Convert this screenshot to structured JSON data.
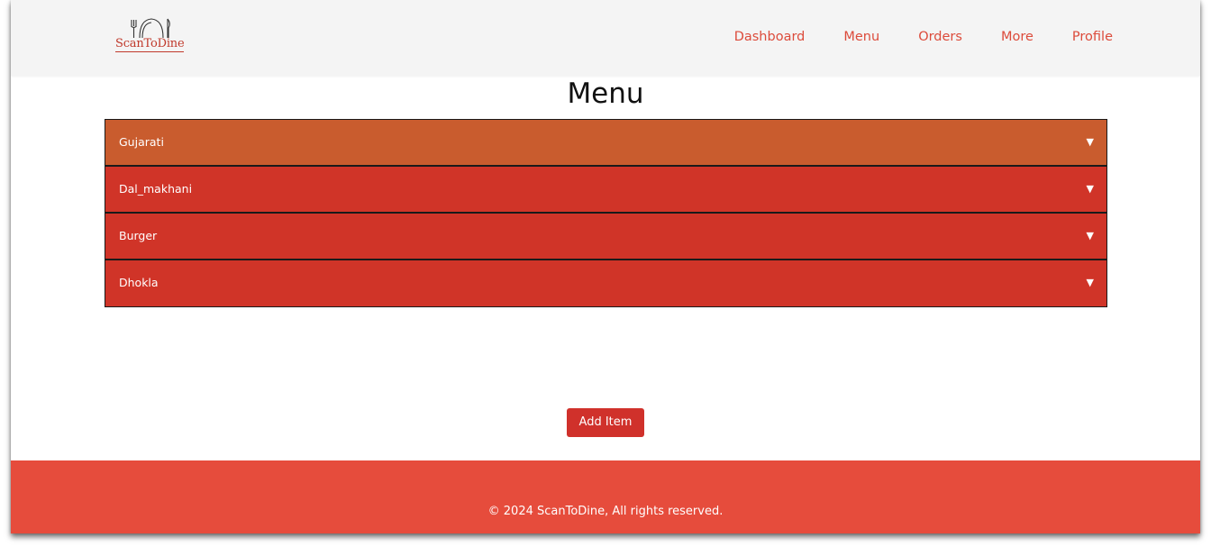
{
  "brand": {
    "logo_text": "ScanToDine"
  },
  "nav": {
    "items": [
      {
        "label": "Dashboard"
      },
      {
        "label": "Menu"
      },
      {
        "label": "Orders"
      },
      {
        "label": "More"
      },
      {
        "label": "Profile"
      }
    ]
  },
  "page": {
    "title": "Menu"
  },
  "menu_categories": [
    {
      "label": "Gujarati",
      "state": "active",
      "arrow_icon": "caret-down-icon"
    },
    {
      "label": "Dal_makhani",
      "state": "default",
      "arrow_icon": "caret-down-icon"
    },
    {
      "label": "Burger",
      "state": "default",
      "arrow_icon": "caret-down-icon"
    },
    {
      "label": "Dhokla",
      "state": "default",
      "arrow_icon": "caret-down-icon"
    }
  ],
  "arrow_glyph": "▼",
  "actions": {
    "add_item_label": "Add Item"
  },
  "footer": {
    "text": "© 2024 ScanToDine, All rights reserved."
  },
  "colors": {
    "brand": "#dc4b3b",
    "active_row": "#c95c2e",
    "row": "#d03428",
    "footer": "#e64c3c",
    "button": "#d0312b"
  }
}
